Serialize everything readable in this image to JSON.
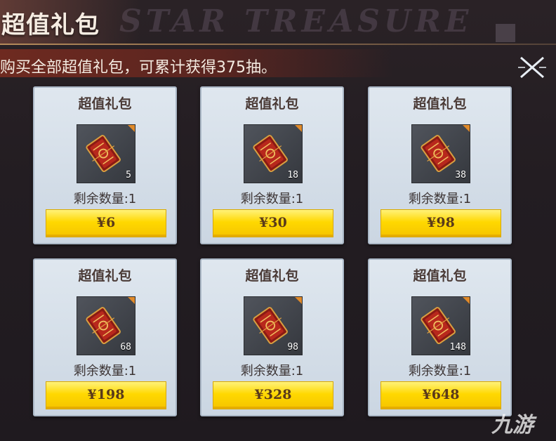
{
  "header": {
    "title": "超值礼包",
    "background_text": "STAR TREASURE",
    "subtitle": "购买全部超值礼包，可累计获得375抽。"
  },
  "cards": [
    {
      "title": "超值礼包",
      "count": "5",
      "remaining": "剩余数量:1",
      "price": "¥6"
    },
    {
      "title": "超值礼包",
      "count": "18",
      "remaining": "剩余数量:1",
      "price": "¥30"
    },
    {
      "title": "超值礼包",
      "count": "38",
      "remaining": "剩余数量:1",
      "price": "¥98"
    },
    {
      "title": "超值礼包",
      "count": "68",
      "remaining": "剩余数量:1",
      "price": "¥198"
    },
    {
      "title": "超值礼包",
      "count": "98",
      "remaining": "剩余数量:1",
      "price": "¥328"
    },
    {
      "title": "超值礼包",
      "count": "148",
      "remaining": "剩余数量:1",
      "price": "¥648"
    }
  ],
  "icons": {
    "close": "close-icon",
    "item": "ticket-bundle-icon"
  },
  "colors": {
    "accent": "#ffd800",
    "subtitle_bar": "#6e2a20",
    "card_bg": "#dfe7ef"
  },
  "watermark": "九游"
}
